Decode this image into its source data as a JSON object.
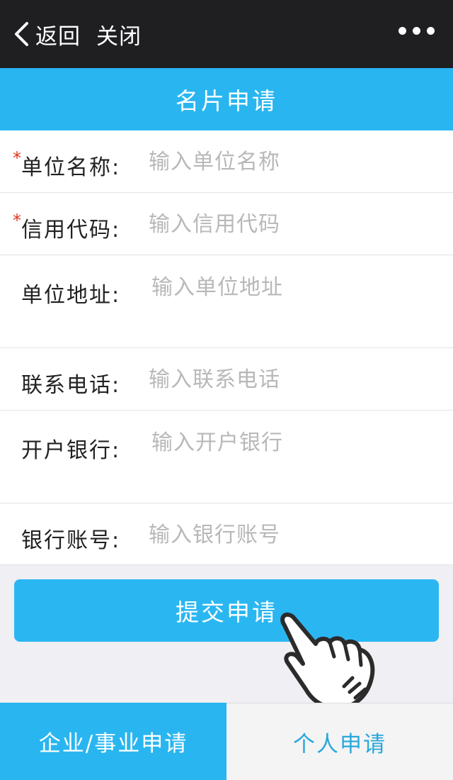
{
  "nav": {
    "back_label": "返回",
    "close_label": "关闭"
  },
  "page": {
    "title": "名片申请"
  },
  "form": {
    "fields": [
      {
        "label": "单位名称:",
        "placeholder": "输入单位名称",
        "required": true
      },
      {
        "label": "信用代码:",
        "placeholder": "输入信用代码",
        "required": true
      },
      {
        "label": "单位地址:",
        "placeholder": "输入单位地址",
        "required": false
      },
      {
        "label": "联系电话:",
        "placeholder": "输入联系电话",
        "required": false
      },
      {
        "label": "开户银行:",
        "placeholder": "输入开户银行",
        "required": false
      },
      {
        "label": "银行账号:",
        "placeholder": "输入银行账号",
        "required": false
      }
    ],
    "required_mark": "*",
    "submit_label": "提交申请"
  },
  "tabs": [
    {
      "label": "企业/事业申请",
      "active": true
    },
    {
      "label": "个人申请",
      "active": false
    }
  ],
  "colors": {
    "navbar": "#1f1f22",
    "accent": "#29b6f0",
    "required": "#e0321b",
    "inactive_tab_text": "#29a7db"
  },
  "icons": {
    "back": "chevron-left-icon",
    "more": "more-dots-icon",
    "pointer": "pointing-hand-icon"
  }
}
